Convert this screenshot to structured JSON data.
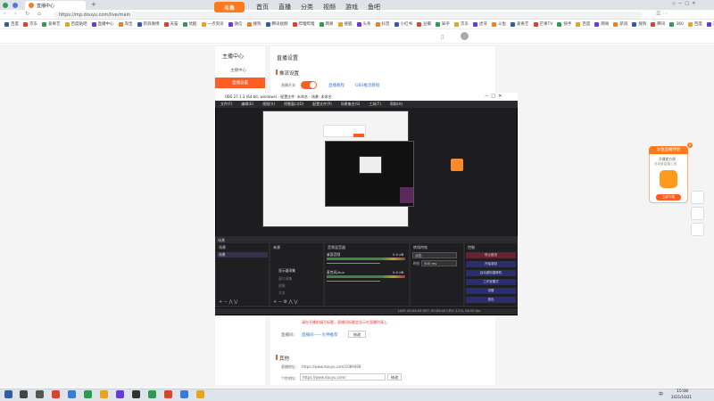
{
  "browser": {
    "tab_title": "直播中心",
    "url": "https://mp.douyu.com/live/main",
    "bookmarks": [
      "百度",
      "京东",
      "爱奇艺",
      "百度贴吧",
      "直播中心",
      "淘宝",
      "新浪微博",
      "天猫",
      "优酷",
      "一点资讯",
      "微信",
      "搜狗",
      "腾讯视频",
      "哔哩哔哩",
      "网易",
      "搜狐",
      "头条",
      "抖音",
      "小红书",
      "豆瓣",
      "知乎",
      "京东",
      "虎牙",
      "斗鱼",
      "爱奇艺",
      "芒果TV",
      "快手",
      "百度",
      "网易",
      "新浪",
      "搜狗",
      "腾讯",
      "360",
      "百度",
      "京东",
      "天猫",
      "优酷"
    ]
  },
  "site": {
    "logo": "斗鱼",
    "nav": [
      "首页",
      "直播",
      "分类",
      "视频",
      "游戏",
      "鱼吧"
    ],
    "sidebar_title": "主播中心",
    "sidebar_inactive": "主播中心",
    "sidebar_active": "直播设置",
    "content_title": "直播设置",
    "section_title": "推流设置",
    "toggle_label": "直播开关",
    "link1": "直播教程",
    "link2": "OBS推流教程",
    "notice": "请在开播前填写标题，直播间标题会显示在直播列表上",
    "label_name": "直播间：",
    "link_room": "直播间——大神推荐",
    "btn_edit": "修改",
    "sub_section": "其他",
    "addr_label1": "直播地址：",
    "addr_value1": "https://www.douyu.com/1089468",
    "addr_label2": "个性地址：",
    "addr_value2": "https://www.douyu.com/",
    "btn_modify": "修改"
  },
  "obs": {
    "title": "OBS 27.1.3 (64-bit, windows) - 配置文件: 未命名 - 场景: 未命名",
    "menu": [
      "文件(F)",
      "编辑(E)",
      "视图(V)",
      "停靠窗口(D)",
      "配置文件(P)",
      "场景集合(S)",
      "工具(T)",
      "帮助(H)"
    ],
    "dock_titles": [
      "场景",
      "来源",
      "音频混音器",
      "转场特效",
      "控制"
    ],
    "scene": "场景",
    "sources": [
      "显示器采集",
      "窗口采集",
      "图像",
      "文本"
    ],
    "mixer": [
      {
        "name": "桌面音频",
        "db": "0.0 dB"
      },
      {
        "name": "麦克风/Aux",
        "db": "0.0 dB"
      }
    ],
    "transition": {
      "label1": "淡出",
      "label2": "时长",
      "value": "300 ms"
    },
    "controls": [
      "停止推流",
      "开始录制",
      "启动虚拟摄像机",
      "工作室模式",
      "设置",
      "退出"
    ],
    "status": "LIVE: 00:00:03   REC: 00:00:00   CPU: 2.2%, 60.00 fps"
  },
  "float": {
    "head": "斗鱼直播伴侣",
    "line1": "开播更方便",
    "line2": "多场景直播工具",
    "button": "立即下载"
  },
  "taskbar": {
    "time": "15:08",
    "date": "2021/10/21",
    "lang": "中"
  }
}
